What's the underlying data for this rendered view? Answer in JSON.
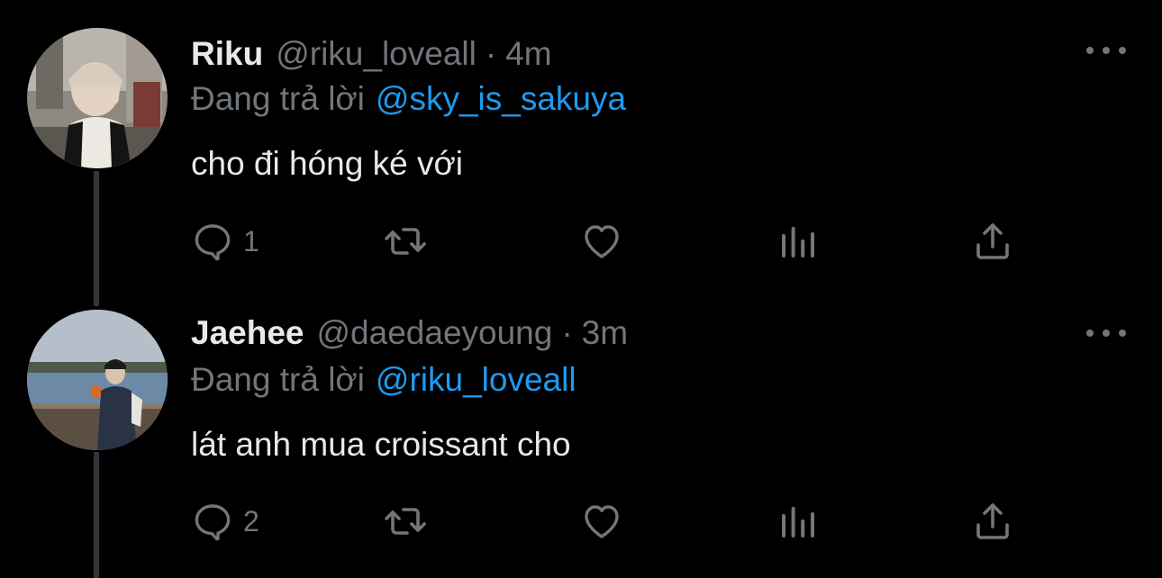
{
  "colors": {
    "background": "#000000",
    "primary_text": "#e7e9ea",
    "secondary_text": "#71767b",
    "mention": "#1d9bf0",
    "thread_line": "#333639"
  },
  "icons": {
    "reply": "speech-bubble-icon",
    "retweet": "retweet-arrows-icon",
    "like": "heart-icon",
    "views": "bar-chart-icon",
    "share": "upload-arrow-icon",
    "more": "three-dots-icon"
  },
  "tweets": [
    {
      "display_name": "Riku",
      "handle": "@riku_loveall",
      "separator": "·",
      "time": "4m",
      "reply_prefix": "Đang trả lời",
      "reply_to": "@sky_is_sakuya",
      "text": "cho đi hóng ké với",
      "reply_count": "1",
      "retweet_count": "",
      "like_count": "",
      "view_count": ""
    },
    {
      "display_name": "Jaehee",
      "handle": "@daedaeyoung",
      "separator": "·",
      "time": "3m",
      "reply_prefix": "Đang trả lời",
      "reply_to": "@riku_loveall",
      "text": "lát anh mua croissant cho",
      "reply_count": "2",
      "retweet_count": "",
      "like_count": "",
      "view_count": ""
    }
  ]
}
